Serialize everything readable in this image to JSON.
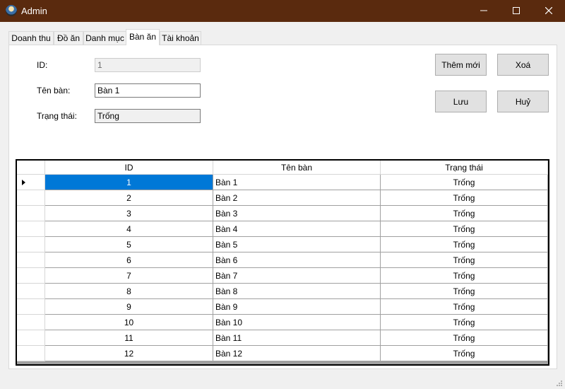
{
  "window": {
    "title": "Admin"
  },
  "tabs": [
    {
      "label": "Doanh thu",
      "active": false
    },
    {
      "label": "Đồ ăn",
      "active": false
    },
    {
      "label": "Danh mục",
      "active": false
    },
    {
      "label": "Bàn ăn",
      "active": true
    },
    {
      "label": "Tài khoản",
      "active": false
    }
  ],
  "form": {
    "id_label": "ID:",
    "id_value": "1",
    "name_label": "Tên bàn:",
    "name_value": "Bàn 1",
    "status_label": "Trạng thái:",
    "status_value": "Trống"
  },
  "buttons": {
    "add": "Thêm mới",
    "delete": "Xoá",
    "save": "Lưu",
    "cancel": "Huỷ"
  },
  "grid": {
    "columns": [
      "ID",
      "Tên bàn",
      "Trạng thái"
    ],
    "selected_row": 0,
    "rows": [
      {
        "id": "1",
        "name": "Bàn 1",
        "status": "Trống"
      },
      {
        "id": "2",
        "name": "Bàn 2",
        "status": "Trống"
      },
      {
        "id": "3",
        "name": "Bàn 3",
        "status": "Trống"
      },
      {
        "id": "4",
        "name": "Bàn 4",
        "status": "Trống"
      },
      {
        "id": "5",
        "name": "Bàn 5",
        "status": "Trống"
      },
      {
        "id": "6",
        "name": "Bàn 6",
        "status": "Trống"
      },
      {
        "id": "7",
        "name": "Bàn 7",
        "status": "Trống"
      },
      {
        "id": "8",
        "name": "Bàn 8",
        "status": "Trống"
      },
      {
        "id": "9",
        "name": "Bàn 9",
        "status": "Trống"
      },
      {
        "id": "10",
        "name": "Bàn 10",
        "status": "Trống"
      },
      {
        "id": "11",
        "name": "Bàn 11",
        "status": "Trống"
      },
      {
        "id": "12",
        "name": "Bàn 12",
        "status": "Trống"
      }
    ]
  },
  "colors": {
    "titlebar": "#5a2a0e",
    "selection": "#0078d7"
  }
}
